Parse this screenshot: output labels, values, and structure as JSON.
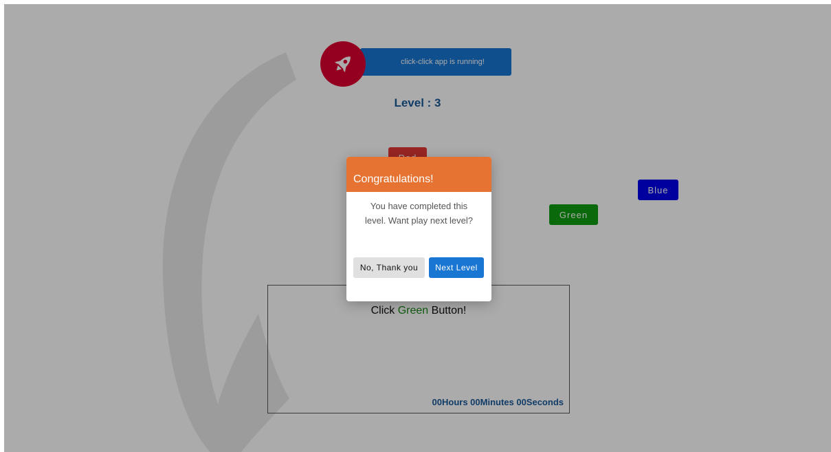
{
  "app": {
    "banner_text": "click-click app is running!",
    "level_label": "Level : 3"
  },
  "buttons": {
    "red": "Red",
    "green": "Green",
    "blue": "Blue"
  },
  "task": {
    "prefix": "Click ",
    "color_word": "Green",
    "suffix": " Button!"
  },
  "timer": "00Hours 00Minutes 00Seconds",
  "dialog": {
    "title": "Congratulations!",
    "message": "You have completed this level. Want play next level?",
    "no_label": "No, Thank you",
    "next_label": "Next Level"
  },
  "icons": {
    "rocket": "rocket-icon"
  },
  "colors": {
    "banner": "#1976d2",
    "rocket_circle": "#dd0031",
    "dialog_header": "#e67332",
    "red_button": "#e53935",
    "green_button": "#0f9d10",
    "blue_button": "#0000ee"
  }
}
